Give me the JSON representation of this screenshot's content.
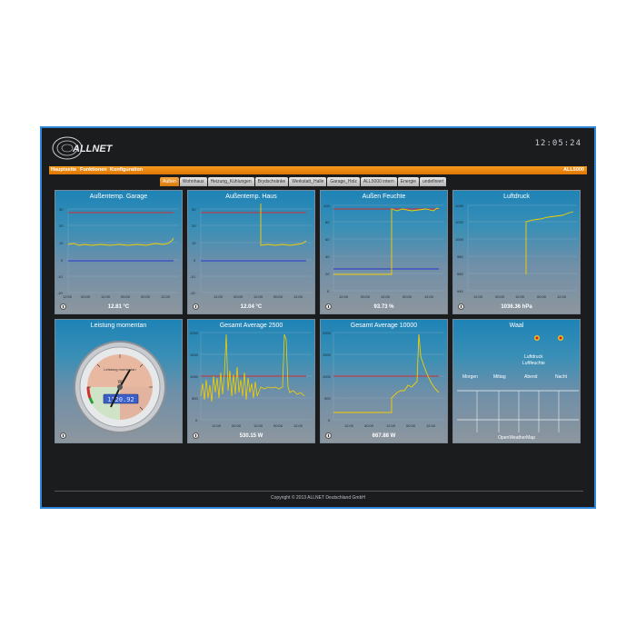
{
  "header": {
    "brand": "ALLNET",
    "clock": "12:05:24"
  },
  "menu": {
    "items": [
      "Hauptseite",
      "Funktionen",
      "Konfiguration"
    ],
    "device": "ALL5000"
  },
  "tabs": [
    "Außen",
    "Wohnhaus",
    "Heizung_Kühlungen",
    "Brydschränke",
    "Werkstatt_Halle",
    "Garage_Holz",
    "ALL5000 intern",
    "Energie",
    "undefiniert"
  ],
  "active_tab": "Außen",
  "colors": {
    "accent": "#f08a10",
    "line": "#f5d000",
    "upper_limit": "#d23030",
    "lower_limit": "#2233d0"
  },
  "panels": {
    "aussentemp_garage": {
      "title": "Außentemp. Garage",
      "value": "12.81 °C"
    },
    "aussentemp_haus": {
      "title": "Außentemp. Haus",
      "value": "12.04 °C"
    },
    "aussen_feuchte": {
      "title": "Außen Feuchte",
      "value": "93.73 %"
    },
    "luftdruck": {
      "title": "Luftdruck",
      "value": "1036.36 hPa"
    },
    "leistung": {
      "title": "Leistung momentan",
      "gauge_label": "Leistung momentan",
      "display": "1120.92",
      "unit": "W"
    },
    "avg2500": {
      "title": "Gesamt Average 2500",
      "value": "530.15 W"
    },
    "avg10000": {
      "title": "Gesamt Average 10000",
      "value": "667.88 W"
    },
    "waal": {
      "title": "Waal",
      "rows": [
        "Luftdruck",
        "Luftfeuchte"
      ],
      "columns": [
        "Morgen",
        "Mittag",
        "Abend",
        "Nacht"
      ],
      "source": "OpenWeatherMap"
    }
  },
  "footer": {
    "copyright": "Copyright © 2013 ALLNET Deutschland GmbH"
  }
}
